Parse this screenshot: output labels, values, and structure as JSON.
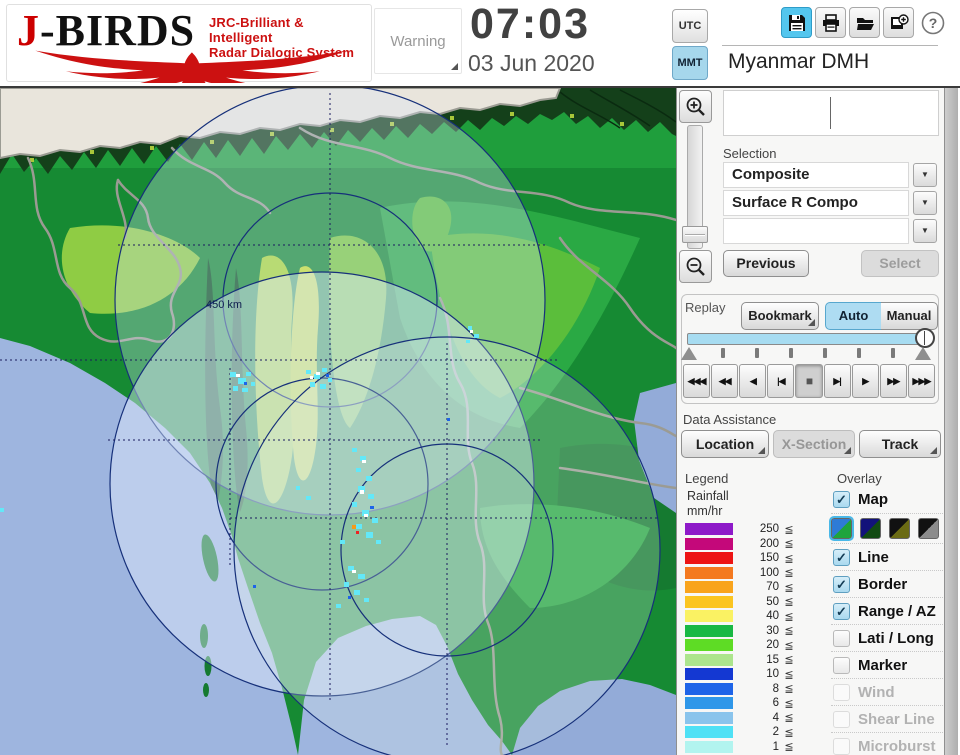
{
  "header": {
    "logo": {
      "brand_j": "J",
      "brand_rest": "-BIRDS",
      "tagline_line1": "JRC-Brilliant & Intelligent",
      "tagline_line2": "Radar  Dialogic  System"
    },
    "warning_button": "Warning",
    "clock": {
      "time": "07:03",
      "date": "03 Jun 2020"
    },
    "timezone": {
      "utc": "UTC",
      "mmt": "MMT",
      "selected": "MMT"
    },
    "toolbar_help_glyph": "?",
    "station_name": "Myanmar DMH"
  },
  "map": {
    "range_ring_label": "450 km"
  },
  "panel": {
    "selection": {
      "label": "Selection",
      "dropdowns": [
        {
          "value": "Composite"
        },
        {
          "value": "Surface R Compo"
        },
        {
          "value": ""
        }
      ],
      "previous_button": "Previous",
      "select_button": "Select"
    },
    "replay": {
      "label": "Replay",
      "bookmark_button": "Bookmark",
      "auto_button": "Auto",
      "manual_button": "Manual",
      "mode_selected": "Auto",
      "playback_buttons": [
        {
          "name": "jump-start",
          "glyph": "◀◀◀"
        },
        {
          "name": "rewind",
          "glyph": "◀◀"
        },
        {
          "name": "play-reverse",
          "glyph": "◀"
        },
        {
          "name": "step-back",
          "glyph": "|◀"
        },
        {
          "name": "stop",
          "glyph": "■"
        },
        {
          "name": "step-forward",
          "glyph": "▶|"
        },
        {
          "name": "play",
          "glyph": "▶"
        },
        {
          "name": "forward",
          "glyph": "▶▶"
        },
        {
          "name": "jump-end",
          "glyph": "▶▶▶"
        }
      ]
    },
    "data_assistance": {
      "label": "Data Assistance",
      "location_button": "Location",
      "xsection_button": "X-Section",
      "track_button": "Track"
    },
    "legend": {
      "label": "Legend",
      "unit_line1": "Rainfall",
      "unit_line2": "mm/hr",
      "lte_symbol": "≦",
      "rows": [
        {
          "value": "250",
          "color": "#8E1AC9"
        },
        {
          "value": "200",
          "color": "#C4087A"
        },
        {
          "value": "150",
          "color": "#ED1414"
        },
        {
          "value": "100",
          "color": "#F4791F"
        },
        {
          "value": "70",
          "color": "#F9A41C"
        },
        {
          "value": "50",
          "color": "#FBC520"
        },
        {
          "value": "40",
          "color": "#FAF263"
        },
        {
          "value": "30",
          "color": "#19B844"
        },
        {
          "value": "20",
          "color": "#5EDC25"
        },
        {
          "value": "15",
          "color": "#ACE58D"
        },
        {
          "value": "10",
          "color": "#1438D2"
        },
        {
          "value": "8",
          "color": "#1E64E8"
        },
        {
          "value": "6",
          "color": "#2F97E9"
        },
        {
          "value": "4",
          "color": "#8AC4EC"
        },
        {
          "value": "2",
          "color": "#4FE1F5"
        },
        {
          "value": "1",
          "color": "#B2F4EF"
        }
      ]
    },
    "overlay": {
      "label": "Overlay",
      "check_glyph": "✓",
      "items": [
        {
          "label": "Map",
          "checked": true,
          "enabled": true
        },
        {
          "label": "Line",
          "checked": true,
          "enabled": true
        },
        {
          "label": "Border",
          "checked": true,
          "enabled": true
        },
        {
          "label": "Range / AZ",
          "checked": true,
          "enabled": true
        },
        {
          "label": "Lati / Long",
          "checked": false,
          "enabled": true
        },
        {
          "label": "Marker",
          "checked": false,
          "enabled": true
        },
        {
          "label": "Wind",
          "checked": false,
          "enabled": false
        },
        {
          "label": "Shear Line",
          "checked": false,
          "enabled": false
        },
        {
          "label": "Microburst",
          "checked": false,
          "enabled": false
        }
      ],
      "map_styles": [
        {
          "colors": [
            "#2E7BD6",
            "#1FA43C"
          ],
          "selected": true
        },
        {
          "colors": [
            "#12127A",
            "#124A12"
          ],
          "selected": false
        },
        {
          "colors": [
            "#111111",
            "#6B6B14"
          ],
          "selected": false
        },
        {
          "colors": [
            "#111111",
            "#8C8C8C"
          ],
          "selected": false
        }
      ]
    }
  }
}
